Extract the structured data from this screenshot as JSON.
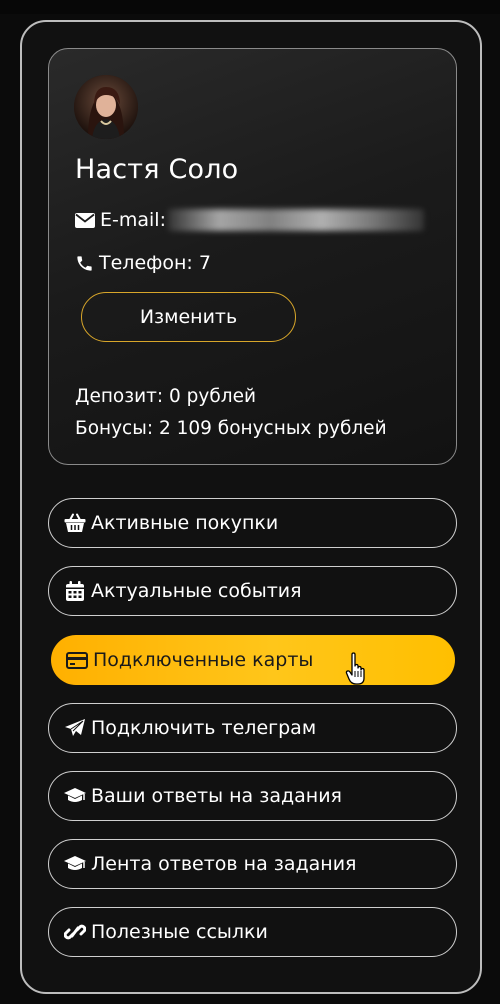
{
  "profile": {
    "name": "Настя Соло",
    "email_label": "E-mail:",
    "phone_label": "Телефон:",
    "phone_value": "7",
    "edit_button": "Изменить",
    "deposit": "Депозит: 0 рублей",
    "bonuses": "Бонусы: 2 109 бонусных рублей"
  },
  "menu": [
    {
      "label": "Активные покупки",
      "icon": "basket-icon"
    },
    {
      "label": "Актуальные события",
      "icon": "calendar-icon"
    },
    {
      "label": "Подключенные карты",
      "icon": "credit-card-icon",
      "active": true
    },
    {
      "label": "Подключить телеграм",
      "icon": "paper-plane-icon"
    },
    {
      "label": "Ваши ответы на задания",
      "icon": "graduation-cap-icon"
    },
    {
      "label": "Лента ответов на задания",
      "icon": "graduation-cap-icon"
    },
    {
      "label": "Полезные ссылки",
      "icon": "link-icon"
    }
  ],
  "colors": {
    "accent": "#ffbf1a",
    "button_border": "#d8a62a",
    "background": "#111111"
  }
}
